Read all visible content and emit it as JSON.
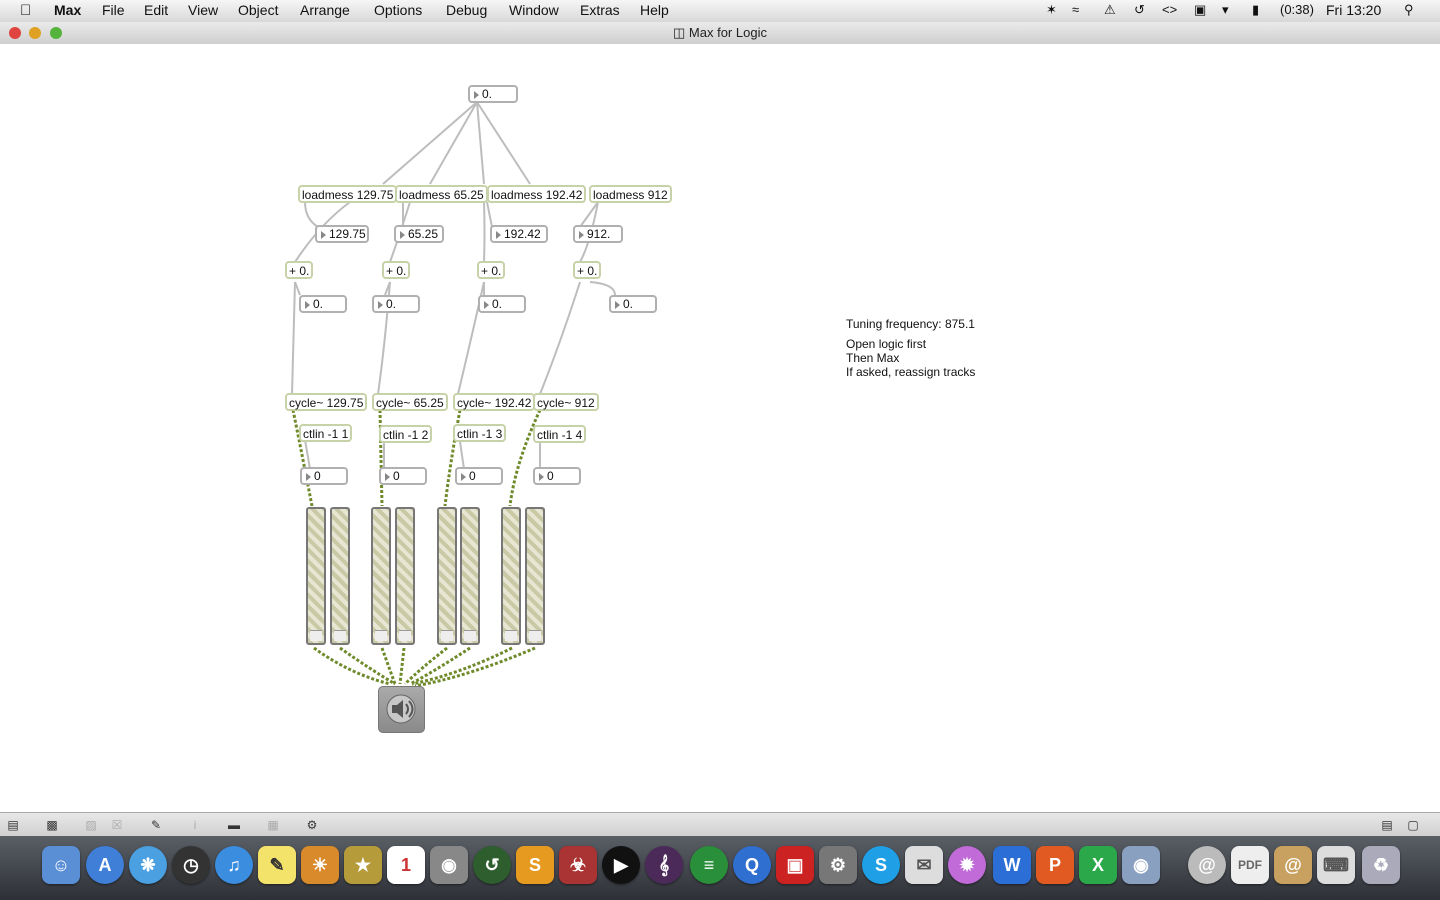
{
  "menubar": {
    "app": "Max",
    "items": [
      "File",
      "Edit",
      "View",
      "Object",
      "Arrange",
      "Options",
      "Debug",
      "Window",
      "Extras",
      "Help"
    ],
    "battery": "(0:38)",
    "clock": "Fri 13:20"
  },
  "window": {
    "title": "Max for Logic"
  },
  "patch": {
    "top_number": "0.",
    "loadmess": [
      "loadmess 129.75",
      "loadmess 65.25",
      "loadmess 192.42",
      "loadmess 912"
    ],
    "values": [
      "129.75",
      "65.25",
      "192.42",
      "912."
    ],
    "plus": [
      "+ 0.",
      "+ 0.",
      "+ 0.",
      "+ 0."
    ],
    "outs": [
      "0.",
      "0.",
      "0.",
      "0.",
      "0."
    ],
    "cycles": [
      "cycle~ 129.75",
      "cycle~ 65.25",
      "cycle~ 192.42",
      "cycle~ 912"
    ],
    "ctlins": [
      "ctlin -1 1",
      "ctlin -1 2",
      "ctlin -1 3",
      "ctlin -1 4"
    ],
    "ctl_values": [
      "0",
      "0",
      "0",
      "0"
    ]
  },
  "notes": {
    "tuning": "Tuning frequency: 875.1",
    "line1": "Open logic first",
    "line2": "Then Max",
    "line3": "If asked, reassign tracks"
  },
  "colors": {
    "object_border": "#c8d2a8",
    "patchcord_audio": "#9bb34a"
  },
  "dock_icons": [
    "finder-icon",
    "app-store-icon",
    "safari-icon",
    "dashboard-icon",
    "itunes-icon",
    "stickies-icon",
    "iphoto-icon",
    "photo-booth-icon",
    "imovie-icon",
    "ical-icon",
    "disk-utility-icon",
    "time-machine-icon",
    "sublime-icon",
    "sculpture-icon",
    "addressbook-icon",
    "live-icon",
    "max-icon",
    "spotify-icon",
    "quicktime-icon",
    "photo-icon",
    "flip-icon",
    "system-prefs-icon",
    "skype-icon",
    "mail-icon",
    "gpu-icon",
    "word-icon",
    "powerpoint-icon",
    "excel-icon",
    "preview-icon",
    "downloads-icon",
    "pdf-icon",
    "documents-icon",
    "keyboard-icon",
    "trash-icon"
  ]
}
